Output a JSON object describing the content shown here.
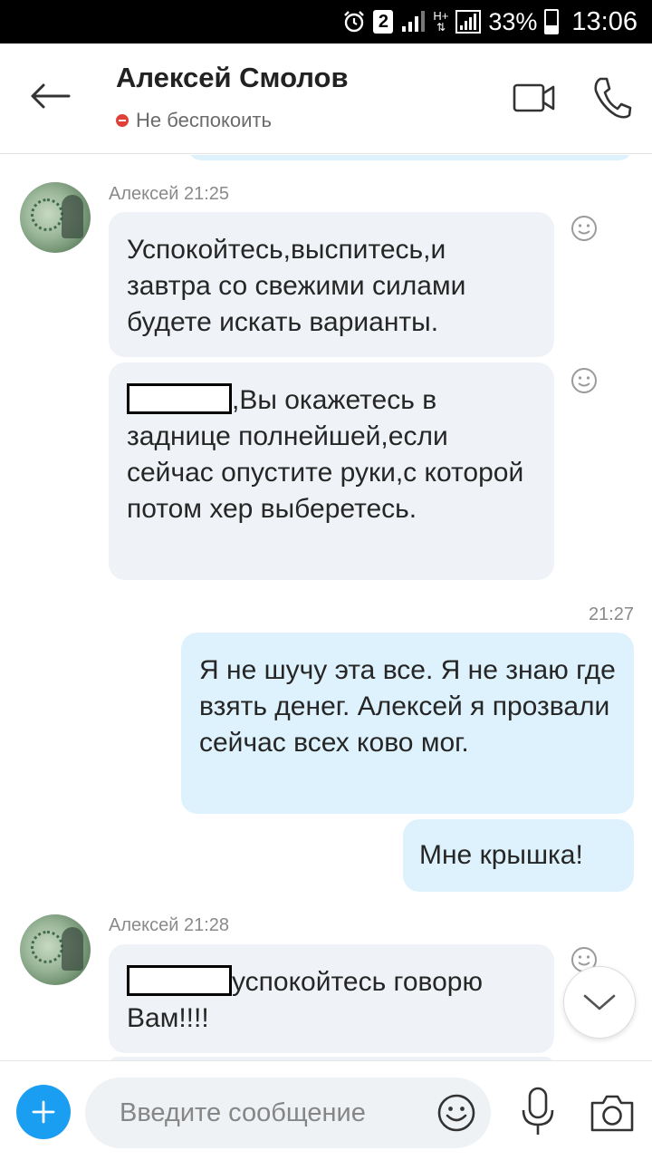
{
  "status_bar": {
    "alarm_icon": "alarm-icon",
    "sim_number": "2",
    "network_type": "H+",
    "battery_percent": "33%",
    "battery_level": 0.33,
    "time": "13:06"
  },
  "header": {
    "contact_name": "Алексей Смолов",
    "presence_status": "Не беспокоить",
    "presence_color": "#e0403a",
    "icons": [
      "back-arrow-icon",
      "video-call-icon",
      "phone-icon"
    ]
  },
  "messages": [
    {
      "direction": "incoming",
      "sender_meta": "Алексей 21:25",
      "parts": [
        {
          "text": "Успокойтесь,выспитесь,и завтра со свежими силами будете искать варианты."
        },
        {
          "redacted": true,
          "text": ",Вы окажетесь в заднице полнейшей,если сейчас опустите руки,с которой потом хер выберетесь."
        }
      ]
    },
    {
      "direction": "outgoing",
      "time": "21:27",
      "parts": [
        {
          "text": "Я не шучу эта все. Я не знаю где взять денег. Алексей я прозвали сейчас всех ково мог."
        },
        {
          "text": "Мне крышка!"
        }
      ]
    },
    {
      "direction": "incoming",
      "sender_meta": "Алексей 21:28",
      "parts": [
        {
          "redacted": true,
          "text": "успокойтесь говорю Вам!!!!"
        }
      ]
    }
  ],
  "composer": {
    "placeholder": "Введите сообщение",
    "accent_color": "#1a9ef1",
    "icons": [
      "plus-icon",
      "emoji-icon",
      "microphone-icon",
      "camera-icon"
    ]
  },
  "colors": {
    "incoming_bubble": "#eff3f7",
    "outgoing_bubble": "#def2fd"
  }
}
